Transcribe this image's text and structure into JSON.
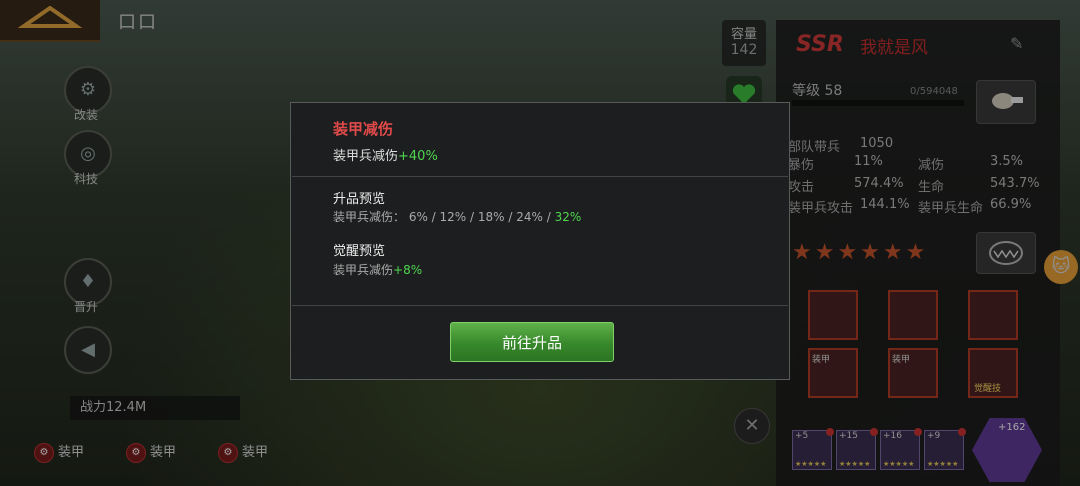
{
  "top": {
    "title": "口口"
  },
  "left_buttons": [
    {
      "label": "改装",
      "icon": "wrench-dino-icon"
    },
    {
      "label": "科技",
      "icon": "tech-icon"
    },
    {
      "label": "晋升",
      "icon": "rank-icon"
    }
  ],
  "power": "战力12.4M",
  "armor_chips": [
    "装甲",
    "装甲",
    "装甲"
  ],
  "capacity": {
    "title": "容量",
    "value": "142"
  },
  "hero": {
    "rarity": "SSR",
    "name": "我就是风",
    "level_label": "等级 58",
    "exp": "0/594048",
    "troops_label": "部队带兵",
    "troops_value": "1050",
    "stats": [
      {
        "label": "暴伤",
        "value": "11%"
      },
      {
        "label": "减伤",
        "value": "3.5%"
      },
      {
        "label": "攻击",
        "value": "574.4%"
      },
      {
        "label": "生命",
        "value": "543.7%"
      },
      {
        "label": "装甲兵攻击",
        "value": "144.1%"
      },
      {
        "label": "装甲兵生命",
        "value": "66.9%"
      }
    ],
    "stars": "★★★★★★",
    "item_tags": [
      "装甲",
      "装甲"
    ],
    "item_bottom_tag": "觉醒技",
    "equip_plus": [
      "+5",
      "+15",
      "+16",
      "+9"
    ],
    "big_plus": "+162"
  },
  "modal": {
    "title": "装甲减伤",
    "line1_text": "装甲兵减伤",
    "line1_bonus": "+40%",
    "upgrade_title": "升品预览",
    "upgrade_text": "装甲兵减伤： 6% / 12% / 18% / 24% / ",
    "upgrade_final": "32%",
    "awaken_title": "觉醒预览",
    "awaken_text": "装甲兵减伤",
    "awaken_bonus": "+8%",
    "button": "前往升品"
  },
  "colors": {
    "accent_red": "#e04a4a",
    "bonus_green": "#4fd64f",
    "button_green": "#37882b"
  }
}
